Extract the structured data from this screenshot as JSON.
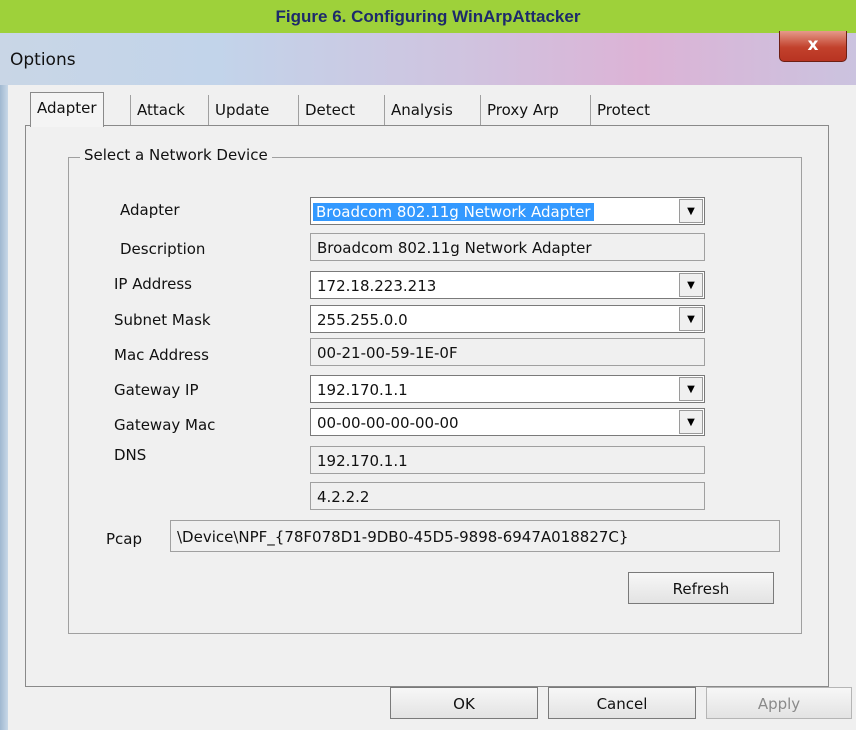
{
  "caption": "Figure 6. Configuring WinArpAttacker",
  "window": {
    "title": "Options",
    "close_glyph": "x"
  },
  "tabs": [
    {
      "label": "Adapter"
    },
    {
      "label": "Attack"
    },
    {
      "label": "Update"
    },
    {
      "label": "Detect"
    },
    {
      "label": "Analysis"
    },
    {
      "label": "Proxy Arp"
    },
    {
      "label": "Protect"
    }
  ],
  "group_title": "Select a Network Device",
  "fields": {
    "adapter": {
      "label": "Adapter",
      "value": "Broadcom 802.11g Network Adapter"
    },
    "description": {
      "label": "Description",
      "value": "Broadcom 802.11g Network Adapter"
    },
    "ip": {
      "label": "IP Address",
      "value": "172.18.223.213"
    },
    "subnet": {
      "label": "Subnet Mask",
      "value": "255.255.0.0"
    },
    "mac": {
      "label": "Mac Address",
      "value": "00-21-00-59-1E-0F"
    },
    "gateway_ip": {
      "label": "Gateway IP",
      "value": "192.170.1.1"
    },
    "gateway_mac": {
      "label": "Gateway Mac",
      "value": "00-00-00-00-00-00"
    },
    "dns": {
      "label": "DNS",
      "value1": "192.170.1.1",
      "value2": "4.2.2.2"
    },
    "pcap": {
      "label": "Pcap",
      "value": "\\Device\\NPF_{78F078D1-9DB0-45D5-9898-6947A018827C}"
    }
  },
  "buttons": {
    "refresh": "Refresh",
    "ok": "OK",
    "cancel": "Cancel",
    "apply": "Apply"
  },
  "colors": {
    "caption_bg": "#9ed13a",
    "caption_text": "#1d2a6b",
    "selection": "#3399ff",
    "close_button": "#c2412c"
  }
}
